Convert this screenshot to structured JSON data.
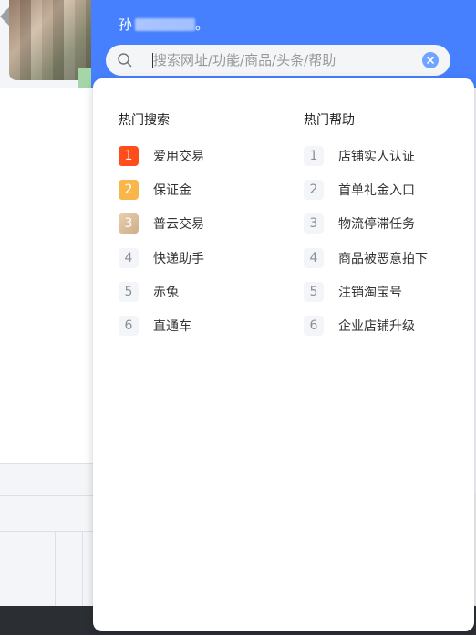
{
  "header": {
    "greeting_prefix": "孙",
    "greeting_suffix": "。"
  },
  "search": {
    "placeholder": "搜索网址/功能/商品/头条/帮助",
    "value": ""
  },
  "hot_search": {
    "title": "热门搜索",
    "items": [
      {
        "rank": "1",
        "label": "爱用交易"
      },
      {
        "rank": "2",
        "label": "保证金"
      },
      {
        "rank": "3",
        "label": "普云交易"
      },
      {
        "rank": "4",
        "label": "快递助手"
      },
      {
        "rank": "5",
        "label": "赤兔"
      },
      {
        "rank": "6",
        "label": "直通车"
      }
    ]
  },
  "hot_help": {
    "title": "热门帮助",
    "items": [
      {
        "rank": "1",
        "label": "店铺实人认证"
      },
      {
        "rank": "2",
        "label": "首单礼金入口"
      },
      {
        "rank": "3",
        "label": "物流停滞任务"
      },
      {
        "rank": "4",
        "label": "商品被恶意拍下"
      },
      {
        "rank": "5",
        "label": "注销淘宝号"
      },
      {
        "rank": "6",
        "label": "企业店铺升级"
      }
    ]
  },
  "colors": {
    "header_bg": "#4680ff",
    "rank1": "#ff4d1c",
    "rank2": "#f9b64b",
    "rank3": "#d9bc98",
    "clear_button": "#6fa4ff"
  },
  "icons": [
    "search-icon",
    "clear-icon",
    "back-arrow-icon"
  ]
}
